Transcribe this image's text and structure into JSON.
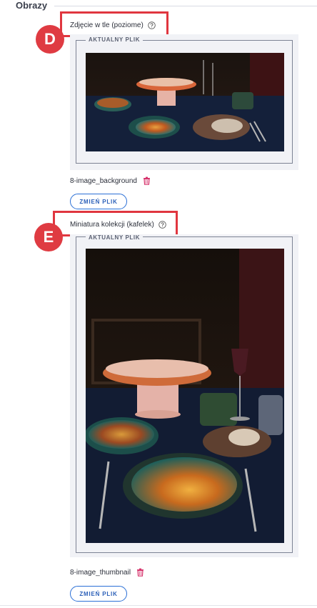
{
  "section": {
    "title": "Obrazy"
  },
  "fields": [
    {
      "label": "Zdjęcie w tle (poziome)",
      "marker": "D",
      "legend": "AKTUALNY PLIK",
      "file_name": "8-image_background",
      "button_label": "ZMIEŃ PLIK"
    },
    {
      "label": "Miniatura kolekcji (kafelek)",
      "marker": "E",
      "legend": "AKTUALNY PLIK",
      "file_name": "8-image_thumbnail",
      "button_label": "ZMIEŃ PLIK"
    }
  ],
  "icons": {
    "help": "question-circle-icon",
    "delete": "trash-icon"
  },
  "colors": {
    "accent": "#2a6fd6",
    "danger": "#d6336c",
    "highlight": "#e0363f"
  }
}
